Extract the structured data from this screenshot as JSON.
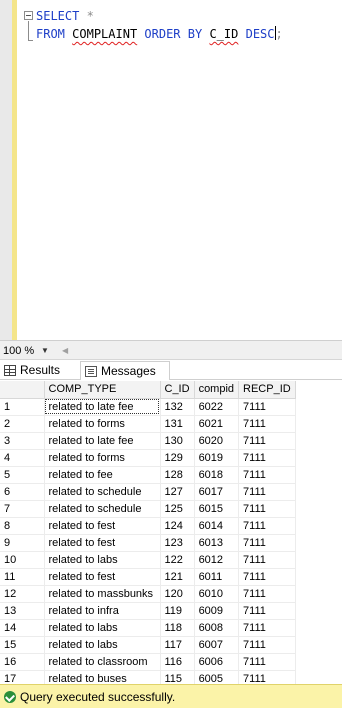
{
  "editor": {
    "line1": {
      "keyword": "SELECT",
      "star": "*"
    },
    "line2": {
      "from": "FROM",
      "table": "COMPLAINT",
      "order": "ORDER",
      "by": "BY",
      "column": "C_ID",
      "dir": "DESC",
      "end": ";"
    }
  },
  "zoom": {
    "level": "100 %"
  },
  "tabs": {
    "results": "Results",
    "messages": "Messages"
  },
  "grid": {
    "columns": [
      "",
      "COMP_TYPE",
      "C_ID",
      "compid",
      "RECP_ID"
    ],
    "rows": [
      [
        "1",
        "related to late fee",
        "132",
        "6022",
        "7111"
      ],
      [
        "2",
        "related to forms",
        "131",
        "6021",
        "7111"
      ],
      [
        "3",
        "related to late fee",
        "130",
        "6020",
        "7111"
      ],
      [
        "4",
        "related to forms",
        "129",
        "6019",
        "7111"
      ],
      [
        "5",
        "related to fee",
        "128",
        "6018",
        "7111"
      ],
      [
        "6",
        "related to schedule",
        "127",
        "6017",
        "7111"
      ],
      [
        "7",
        "related to schedule",
        "125",
        "6015",
        "7111"
      ],
      [
        "8",
        "related to fest",
        "124",
        "6014",
        "7111"
      ],
      [
        "9",
        "related to fest",
        "123",
        "6013",
        "7111"
      ],
      [
        "10",
        "related to labs",
        "122",
        "6012",
        "7111"
      ],
      [
        "11",
        "related to fest",
        "121",
        "6011",
        "7111"
      ],
      [
        "12",
        "related to massbunks",
        "120",
        "6010",
        "7111"
      ],
      [
        "13",
        "related to infra",
        "119",
        "6009",
        "7111"
      ],
      [
        "14",
        "related to labs",
        "118",
        "6008",
        "7111"
      ],
      [
        "15",
        "related to labs",
        "117",
        "6007",
        "7111"
      ],
      [
        "16",
        "related to classroom",
        "116",
        "6006",
        "7111"
      ],
      [
        "17",
        "related to buses",
        "115",
        "6005",
        "7111"
      ]
    ]
  },
  "status": {
    "text": "Query executed successfully.",
    "color": "#2a8f3a"
  }
}
